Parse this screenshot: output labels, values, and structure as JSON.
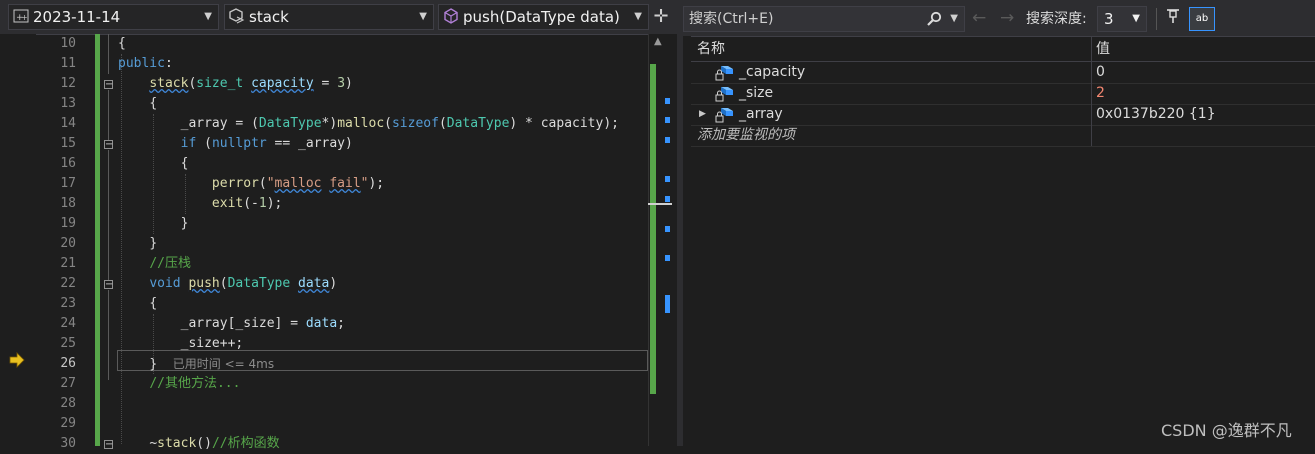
{
  "editor": {
    "nav": {
      "project": "2023-11-14",
      "scope": "stack",
      "member": "push(DataType data)"
    },
    "line_numbers": [
      "10",
      "11",
      "12",
      "13",
      "14",
      "15",
      "16",
      "17",
      "18",
      "19",
      "20",
      "21",
      "22",
      "23",
      "24",
      "25",
      "26",
      "27",
      "28",
      "29",
      "30"
    ],
    "current_line": "26",
    "lines": {
      "l10": "{",
      "l11_kw": "public",
      "l11_rest": ":",
      "l12_fn": "stack",
      "l12_a": "(",
      "l12_ty": "size_t",
      "l12_sp": " ",
      "l12_pm": "capacity",
      "l12_b": " = ",
      "l12_num": "3",
      "l12_c": ")",
      "l13": "{",
      "l14_a": "_array = (",
      "l14_ty": "DataType",
      "l14_b": "*)",
      "l14_fn": "malloc",
      "l14_c": "(",
      "l14_kw": "sizeof",
      "l14_d": "(",
      "l14_ty2": "DataType",
      "l14_e": ") * capacity);",
      "l15_kw": "if",
      "l15_a": " (",
      "l15_kw2": "nullptr",
      "l15_b": " == _array)",
      "l16": "{",
      "l17_fn": "perror",
      "l17_a": "(",
      "l17_str1": "\"",
      "l17_str2": "malloc",
      "l17_str3": " ",
      "l17_str4": "fail",
      "l17_str5": "\"",
      "l17_b": ");",
      "l18_fn": "exit",
      "l18_a": "(-",
      "l18_num": "1",
      "l18_b": ");",
      "l19": "}",
      "l20": "}",
      "l21_cm": "//压栈",
      "l22_kw": "void",
      "l22_sp": " ",
      "l22_fn": "push",
      "l22_a": "(",
      "l22_ty": "DataType",
      "l22_sp2": " ",
      "l22_pm": "data",
      "l22_b": ")",
      "l23": "{",
      "l24_a": "_array[_size] = ",
      "l24_pm": "data",
      "l24_b": ";",
      "l25": "_size++;",
      "l26": "}",
      "l26_elapsed": "已用时间 <= 4ms",
      "l27_cm": "//其他方法...",
      "l30_a": "~",
      "l30_fn": "stack",
      "l30_b": "()",
      "l30_cm": "//析构函数"
    }
  },
  "watch": {
    "search_placeholder": "搜索(Ctrl+E)",
    "depth_label": "搜索深度:",
    "depth_value": "3",
    "hex_label": "ab",
    "columns": {
      "name": "名称",
      "value": "值"
    },
    "rows": [
      {
        "name": "_capacity",
        "value": "0",
        "expandable": false
      },
      {
        "name": "_size",
        "value": "2",
        "expandable": false
      },
      {
        "name": "_array",
        "value": "0x0137b220 {1}",
        "expandable": true
      }
    ],
    "add_item": "添加要监视的项"
  },
  "watermark": "CSDN @逸群不凡",
  "icons": {
    "project": "project-icon",
    "scope": "class-icon",
    "member": "method-icon",
    "breakpoint": "current-statement-arrow-icon",
    "field": "protected-field-icon"
  },
  "colors": {
    "keyword": "#569cd6",
    "type": "#4ec9b0",
    "function": "#dcdcaa",
    "comment": "#57a64a",
    "changed_value": "#f48771",
    "change_bar": "#57a64a"
  }
}
